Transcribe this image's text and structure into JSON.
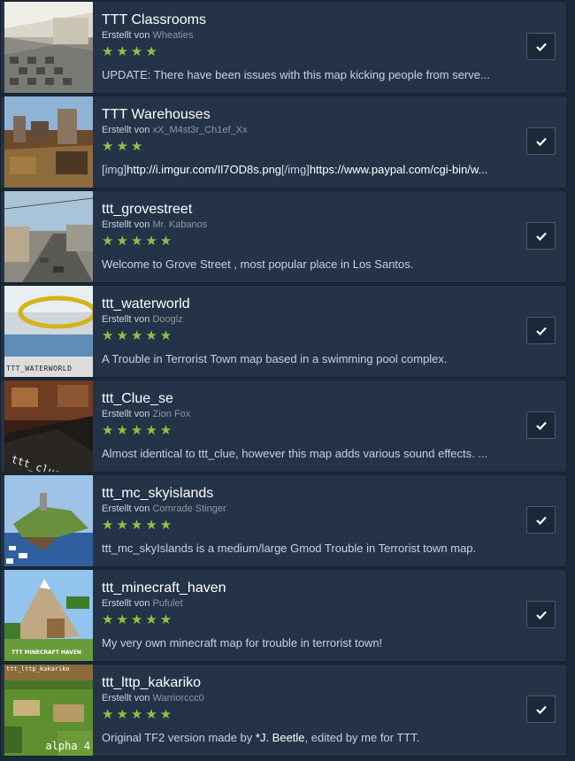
{
  "author_prefix": "Erstellt von",
  "colors": {
    "background": "#1b2838",
    "item_background": "#243348",
    "star": "#8bc53f",
    "title": "#ffffff",
    "text": "#c6d4df",
    "author_name": "#8f98a0"
  },
  "items": [
    {
      "title": "TTT Classrooms",
      "author": "Wheaties",
      "rating": 4,
      "stars": "★★★★",
      "description": "UPDATE: There have been issues with this map kicking people from serve...",
      "thumb_label": "",
      "checked": true
    },
    {
      "title": "TTT Warehouses",
      "author": "xX_M4st3r_Ch1ef_Xx",
      "rating": 3,
      "stars": "★★★",
      "description": {
        "p1": "[img]",
        "p2": "http://i.imgur.com/Il7OD8s.png",
        "p3": "[/img]",
        "p4": "https://www.paypal.com/cgi-bin/w..."
      },
      "thumb_label": "",
      "checked": true
    },
    {
      "title": "ttt_grovestreet",
      "author": "Mr. Kabanos",
      "rating": 5,
      "stars": "★★★★★",
      "description": "Welcome to Grove Street , most popular place in Los Santos.",
      "thumb_label": "",
      "checked": true
    },
    {
      "title": "ttt_waterworld",
      "author": "Dooglz",
      "rating": 5,
      "stars": "★★★★★",
      "description": "A Trouble in Terrorist Town map based in a swimming pool complex.",
      "thumb_label": "TTT_WATERWORLD",
      "checked": true
    },
    {
      "title": "ttt_Clue_se",
      "author": "Zion Fox",
      "rating": 5,
      "stars": "★★★★★",
      "description": "Almost identical to ttt_clue, however this map adds various sound effects. ...",
      "thumb_label": "ttt_clue_se",
      "checked": true
    },
    {
      "title": "ttt_mc_skyislands",
      "author": "Comrade Stinger",
      "rating": 5,
      "stars": "★★★★★",
      "description": "ttt_mc_skyIslands is a medium/large Gmod Trouble in Terrorist town map.",
      "thumb_label": "",
      "checked": true
    },
    {
      "title": "ttt_minecraft_haven",
      "author": "Pufulet",
      "rating": 5,
      "stars": "★★★★★",
      "description": "My very own minecraft map for trouble in terrorist town!",
      "thumb_label": "TTT MINECRAFT HAVEN",
      "checked": true
    },
    {
      "title": "ttt_lttp_kakariko",
      "author": "Warriorccc0",
      "rating": 5,
      "stars": "★★★★★",
      "description": {
        "p1": "Original TF2 version made by ",
        "p2": "*J. Beetle",
        "p3": ", edited by me for TTT."
      },
      "thumb_label": "ttt_lttp_kakariko",
      "thumb_label_2": "alpha 4",
      "checked": true
    }
  ]
}
